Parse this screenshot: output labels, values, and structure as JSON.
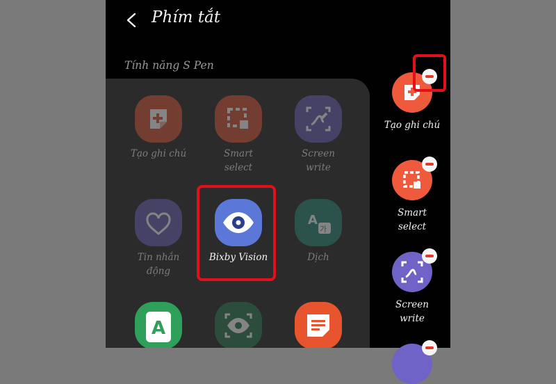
{
  "header": {
    "title": "Phím tắt"
  },
  "section_label": "Tính năng S Pen",
  "apps": [
    {
      "label": "Tạo ghi chú",
      "color": "#d9573c",
      "icon": "create-note-icon"
    },
    {
      "label": "Smart\nselect",
      "color": "#d9573c",
      "icon": "smart-select-icon"
    },
    {
      "label": "Screen\nwrite",
      "color": "#6b62b8",
      "icon": "screen-write-icon"
    },
    {
      "label": "Tin nhắn\nđộng",
      "color": "#6b62b8",
      "icon": "live-message-icon"
    },
    {
      "label": "Bixby Vision",
      "color": "#5b77d8",
      "icon": "eye-icon"
    },
    {
      "label": "Dịch",
      "color": "#2d8a7a",
      "icon": "translate-icon"
    },
    {
      "label": "",
      "color": "#2fa05a",
      "icon": "ar-doodle-icon"
    },
    {
      "label": "",
      "color": "#2f7a55",
      "icon": "magnify-eye-icon"
    },
    {
      "label": "",
      "color": "#e8542e",
      "icon": "notes-list-icon"
    }
  ],
  "shortcuts": [
    {
      "label": "Tạo ghi chú",
      "color": "#ef5a3c",
      "icon": "create-note-icon"
    },
    {
      "label": "Smart\nselect",
      "color": "#ef5a3c",
      "icon": "smart-select-icon"
    },
    {
      "label": "Screen\nwrite",
      "color": "#6f63c8",
      "icon": "screen-write-icon"
    },
    {
      "label": "",
      "color": "#6f63c8",
      "icon": "app-icon"
    }
  ]
}
